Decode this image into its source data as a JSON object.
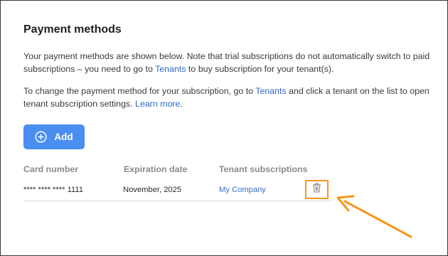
{
  "page": {
    "title": "Payment methods",
    "paragraph1": {
      "text_a": "Your payment methods are shown below. Note that trial subscriptions do not automatically switch to paid subscriptions – you need to go to ",
      "link": "Tenants",
      "text_b": " to buy subscription for your tenant(s)."
    },
    "paragraph2": {
      "text_a": "To change the payment method for your subscription, go to ",
      "link1": "Tenants",
      "text_b": " and click a tenant on the list to open tenant subscription settings. ",
      "link2": "Learn more",
      "text_c": "."
    },
    "add_button": {
      "label": "Add",
      "icon": "plus-circle-icon"
    }
  },
  "table": {
    "headers": [
      "Card number",
      "Expiration date",
      "Tenant subscriptions"
    ],
    "rows": [
      {
        "card_number": "**** **** **** 1111",
        "expiration": "November, 2025",
        "tenant": "My Company",
        "action_icon": "trash-icon"
      }
    ]
  },
  "annotation": {
    "highlight_color": "#f7961b",
    "arrow_color": "#f7961b"
  },
  "colors": {
    "accent": "#4a8ef0",
    "link": "#2f66c9"
  }
}
